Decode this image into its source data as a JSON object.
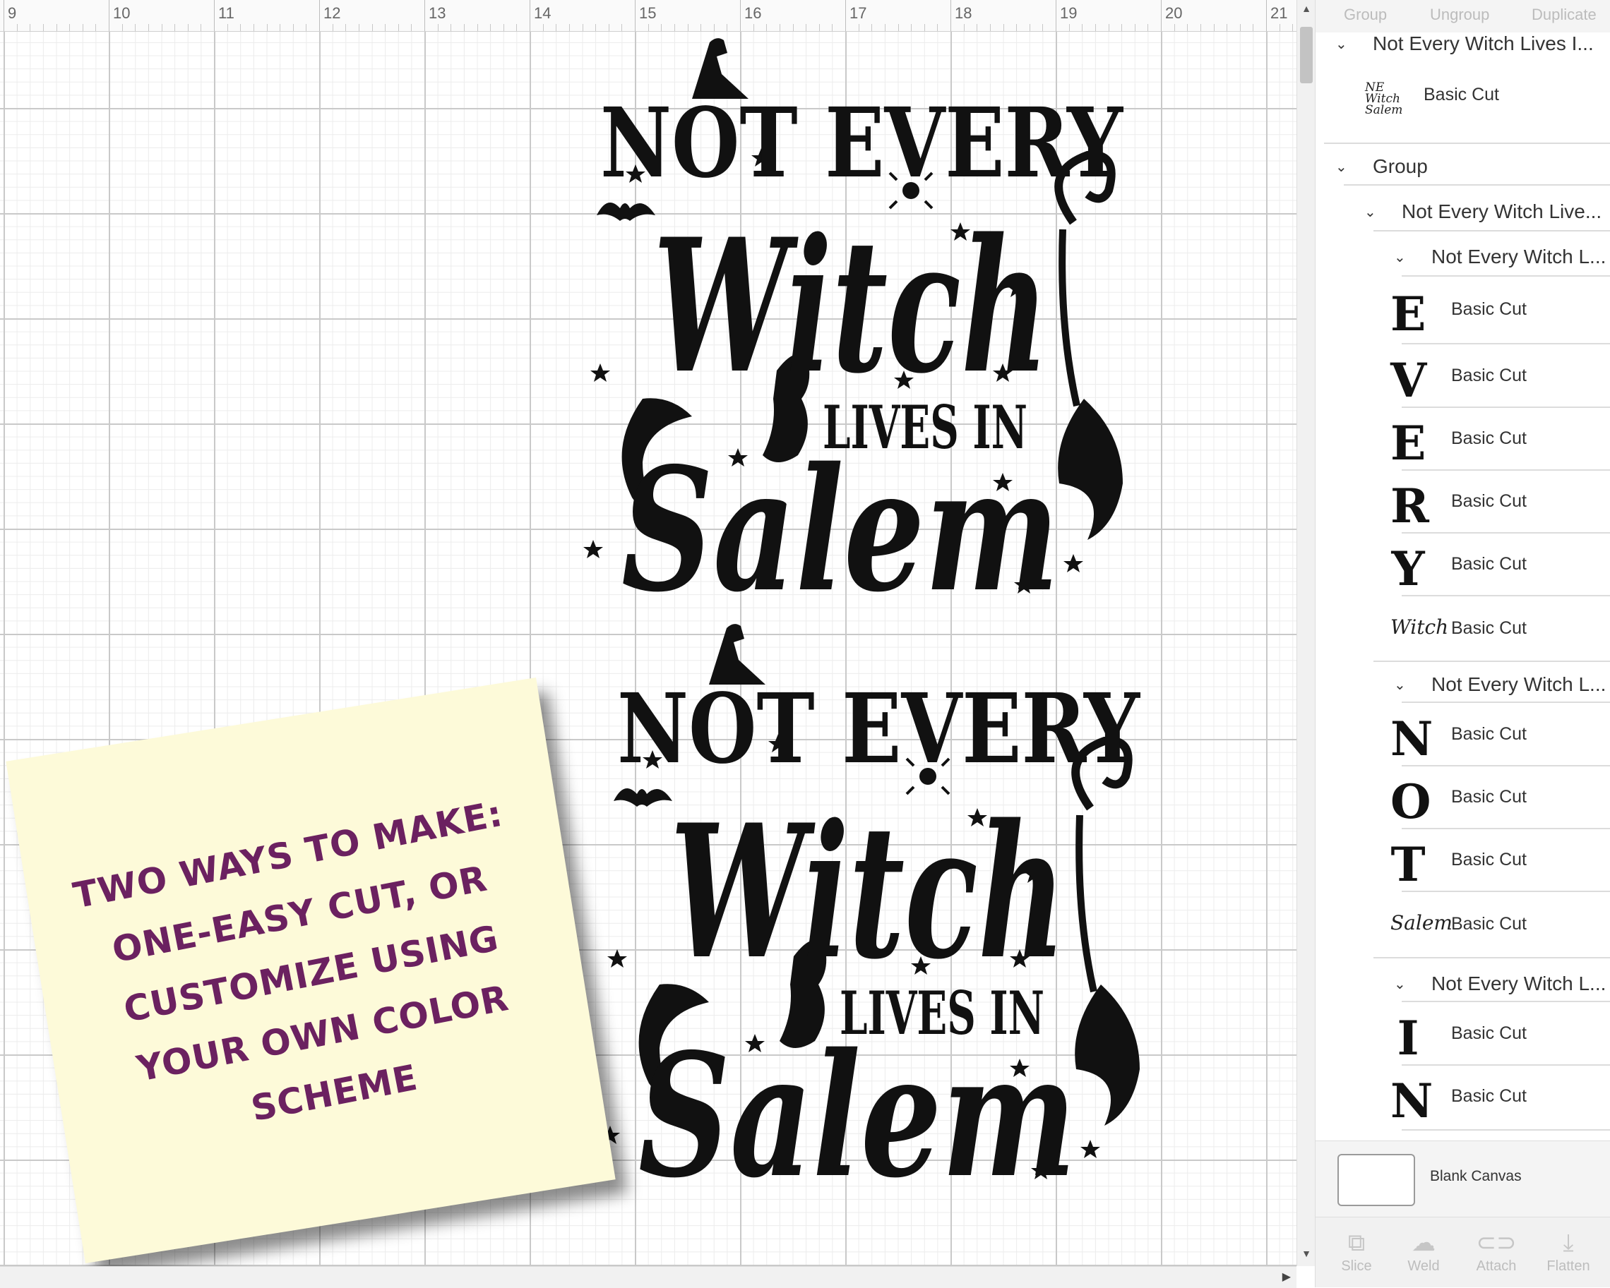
{
  "ruler": {
    "numbers": [
      "9",
      "10",
      "11",
      "12",
      "13",
      "14",
      "15",
      "16",
      "17",
      "18",
      "19",
      "20",
      "21"
    ]
  },
  "designs": [
    {
      "line1": "NOT EVERY",
      "line2": "Witch",
      "line3": "LIVES IN",
      "line4": "Salem"
    },
    {
      "line1": "NOT EVERY",
      "line2": "Witch",
      "line3": "LIVES IN",
      "line4": "Salem"
    }
  ],
  "note": {
    "text": "TWO WAYS TO MAKE:\nONE-EASY CUT, OR\nCUSTOMIZE USING\nYOUR OWN COLOR\nSCHEME"
  },
  "panel": {
    "toolbar": {
      "group": "Group",
      "ungroup": "Ungroup",
      "duplicate": "Duplicate"
    },
    "layers": {
      "top_group": "Not Every Witch Lives I...",
      "top_cut": "Basic Cut",
      "group": "Group",
      "sub_group": "Not Every Witch Live...",
      "letters_group_1": "Not Every Witch L...",
      "items_1": [
        {
          "glyph": "E",
          "label": "Basic Cut"
        },
        {
          "glyph": "V",
          "label": "Basic Cut"
        },
        {
          "glyph": "E",
          "label": "Basic Cut"
        },
        {
          "glyph": "R",
          "label": "Basic Cut"
        },
        {
          "glyph": "Y",
          "label": "Basic Cut"
        },
        {
          "glyph": "Witch",
          "label": "Basic Cut"
        }
      ],
      "letters_group_2": "Not Every Witch L...",
      "items_2": [
        {
          "glyph": "N",
          "label": "Basic Cut"
        },
        {
          "glyph": "O",
          "label": "Basic Cut"
        },
        {
          "glyph": "T",
          "label": "Basic Cut"
        },
        {
          "glyph": "Salem",
          "label": "Basic Cut"
        }
      ],
      "letters_group_3": "Not Every Witch L...",
      "items_3": [
        {
          "glyph": "I",
          "label": "Basic Cut"
        },
        {
          "glyph": "N",
          "label": "Basic Cut"
        }
      ]
    },
    "blank_canvas": "Blank Canvas",
    "tools": [
      "Slice",
      "Weld",
      "Attach",
      "Flatten"
    ]
  },
  "colors": {
    "note_bg": "#fdfad9",
    "note_text": "#6b2160",
    "ink": "#111111",
    "panel_bg": "#f4f4f4"
  }
}
